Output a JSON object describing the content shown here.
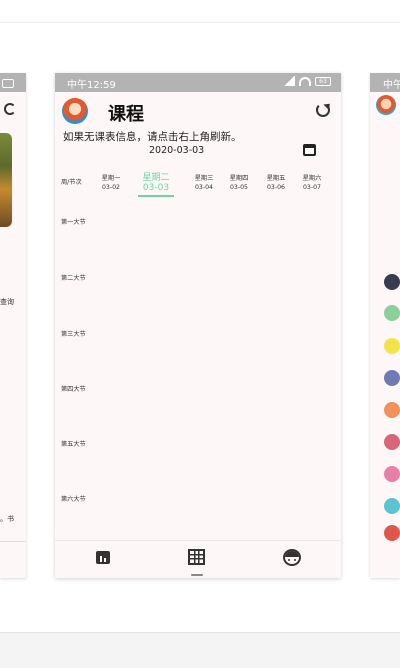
{
  "status_bar": {
    "time": "中午12:59",
    "battery": "63"
  },
  "side_right": {
    "status_time": "中午"
  },
  "side_left": {
    "snippet_1": "查询",
    "snippet_2": "。书"
  },
  "header": {
    "title": "课程"
  },
  "hint": "如果无课表信息，请点击右上角刷新。",
  "current_date": "2020-03-03",
  "week_header": {
    "corner": "周/节次",
    "days": [
      {
        "name": "星期一",
        "date": "03-02"
      },
      {
        "name": "星期二",
        "date": "03-03",
        "active": true
      },
      {
        "name": "星期三",
        "date": "03-04"
      },
      {
        "name": "星期四",
        "date": "03-05"
      },
      {
        "name": "星期五",
        "date": "03-06"
      },
      {
        "name": "星期六",
        "date": "03-07"
      }
    ]
  },
  "periods": [
    "第一大节",
    "第二大节",
    "第三大节",
    "第四大节",
    "第五大节",
    "第六大节"
  ],
  "colors": {
    "accent": "#6ed3a6",
    "status_bar": "#b3b3b3",
    "card_bg": "#fdf8f7"
  },
  "icons": {
    "refresh": "refresh-icon",
    "calendar": "calendar-icon",
    "stats": "bar-chart-icon",
    "grid": "grid-icon",
    "profile": "face-icon"
  }
}
